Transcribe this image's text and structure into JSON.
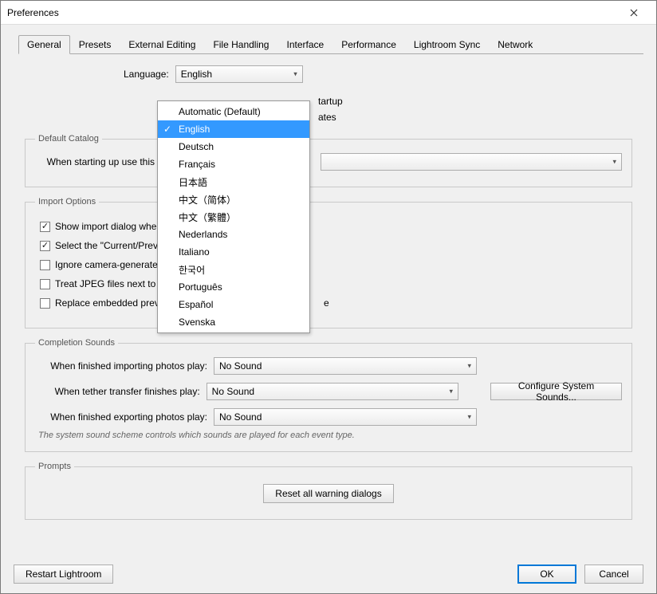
{
  "window": {
    "title": "Preferences"
  },
  "tabs": [
    "General",
    "Presets",
    "External Editing",
    "File Handling",
    "Interface",
    "Performance",
    "Lightroom Sync",
    "Network"
  ],
  "active_tab": 0,
  "lang_label": "Language:",
  "lang_combo_value": "English",
  "lang_options": [
    "Automatic (Default)",
    "English",
    "Deutsch",
    "Français",
    "日本語",
    "中文（简体）",
    "中文（繁體）",
    "Nederlands",
    "Italiano",
    "한국어",
    "Português",
    "Español",
    "Svenska"
  ],
  "lang_selected_index": 1,
  "partial_startup": "tartup",
  "partial_iates": "ates",
  "default_catalog": {
    "legend": "Default Catalog",
    "label": "When starting up use this"
  },
  "import_options": {
    "legend": "Import Options",
    "items": [
      {
        "label": "Show import dialog when a",
        "checked": true
      },
      {
        "label": "Select the \"Current/Previo",
        "checked": true
      },
      {
        "label": "Ignore camera-generated",
        "checked": false
      },
      {
        "label": "Treat JPEG files next to ra",
        "checked": false
      },
      {
        "label": "Replace embedded preview",
        "checked": false
      }
    ],
    "trailing_text": "e"
  },
  "completion_sounds": {
    "legend": "Completion Sounds",
    "rows": [
      {
        "label": "When finished importing photos play:",
        "value": "No Sound"
      },
      {
        "label": "When tether transfer finishes play:",
        "value": "No Sound"
      },
      {
        "label": "When finished exporting photos play:",
        "value": "No Sound"
      }
    ],
    "config_button": "Configure System Sounds...",
    "hint": "The system sound scheme controls which sounds are played for each event type."
  },
  "prompts": {
    "legend": "Prompts",
    "reset_button": "Reset all warning dialogs"
  },
  "footer": {
    "restart": "Restart Lightroom",
    "ok": "OK",
    "cancel": "Cancel"
  }
}
